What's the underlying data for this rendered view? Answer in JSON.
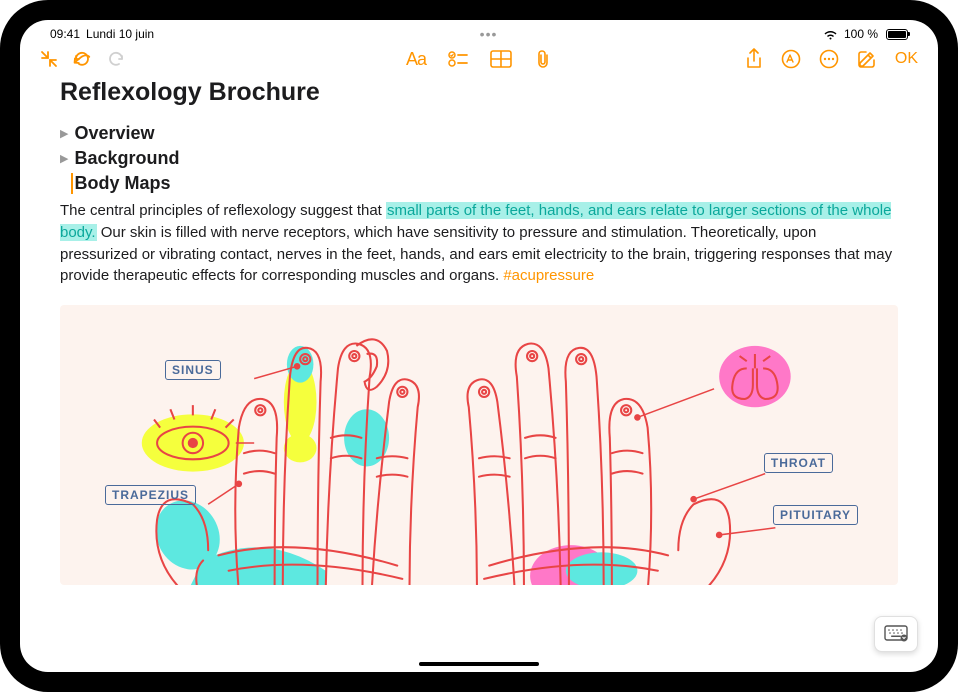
{
  "status": {
    "time": "09:41",
    "date": "Lundi 10 juin",
    "battery": "100 %"
  },
  "toolbar": {
    "done_label": "OK",
    "format_label": "Aa"
  },
  "note": {
    "title": "Reflexology Brochure",
    "sections": [
      {
        "label": "Overview",
        "collapsed": true
      },
      {
        "label": "Background",
        "collapsed": true
      },
      {
        "label": "Body Maps",
        "collapsed": false
      }
    ],
    "body": {
      "pre": "The central principles of reflexology suggest that ",
      "highlight": "small parts of the feet, hands, and ears relate to larger sections of the whole body.",
      "post": " Our skin is filled with nerve receptors, which have sensitivity to pressure and stimulation. Theoretically, upon pressurized or vibrating contact, nerves in the feet, hands, and ears emit electricity to the brain, triggering responses that may provide therapeutic effects for corresponding muscles and organs. ",
      "tag": "#acupressure"
    }
  },
  "drawing_labels": {
    "sinus": "SINUS",
    "trapezius": "TRAPEZIUS",
    "throat": "THROAT",
    "pituitary": "PITUITARY"
  }
}
